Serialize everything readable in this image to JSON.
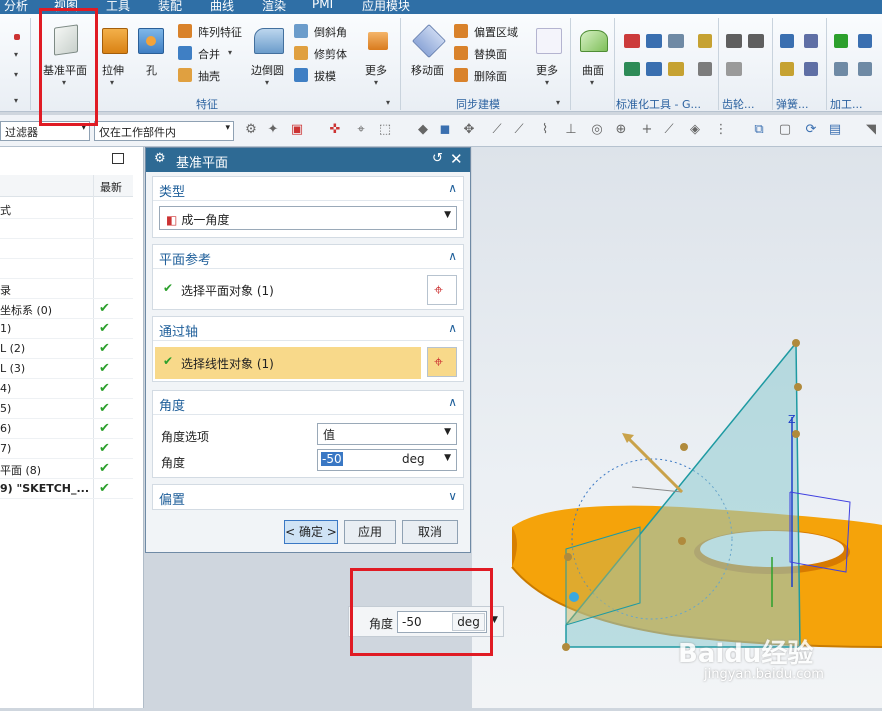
{
  "menubar": {
    "items": [
      "分析",
      "视图",
      "工具",
      "装配",
      "曲线",
      "渲染",
      "PMI",
      "应用模块"
    ]
  },
  "ribbon": {
    "datum_plane": "基准平面",
    "extrude": "拉伸",
    "hole": "孔",
    "pattern": "阵列特征",
    "unite": "合并",
    "shell": "抽壳",
    "edge_blend": "边倒圆",
    "chamfer": "倒斜角",
    "trim_body": "修剪体",
    "draft": "拔模",
    "more1": "更多",
    "group_feature": "特征",
    "move_face": "移动面",
    "offset_region": "偏置区域",
    "replace_face": "替换面",
    "delete_face": "删除面",
    "more2": "更多",
    "group_sync": "同步建模",
    "surface": "曲面",
    "group_std": "标准化工具 - G...",
    "group_gear": "齿轮...",
    "group_spring": "弹簧...",
    "group_machining": "加工..."
  },
  "toolbar2": {
    "filter": "过滤器",
    "scope": "仅在工作部件内"
  },
  "nav": {
    "col_latest": "最新",
    "rows": [
      {
        "label": "式",
        "check": false
      },
      {
        "label": "",
        "check": false
      },
      {
        "label": "",
        "check": false
      },
      {
        "label": "",
        "check": false
      },
      {
        "label": "录",
        "check": false
      },
      {
        "label": "坐标系 (0)",
        "check": true
      },
      {
        "label": "1)",
        "check": true
      },
      {
        "label": "L (2)",
        "check": true
      },
      {
        "label": "L (3)",
        "check": true
      },
      {
        "label": "4)",
        "check": true
      },
      {
        "label": "5)",
        "check": true
      },
      {
        "label": "6)",
        "check": true
      },
      {
        "label": "7)",
        "check": true
      },
      {
        "label": "平面 (8)",
        "check": true
      },
      {
        "label": "9) \"SKETCH_...",
        "check": true
      }
    ]
  },
  "dialog": {
    "title": "基准平面",
    "type": {
      "header": "类型",
      "value": "成一角度"
    },
    "plane_ref": {
      "header": "平面参考",
      "label": "选择平面对象 (1)"
    },
    "through_axis": {
      "header": "通过轴",
      "label": "选择线性对象 (1)"
    },
    "angle": {
      "header": "角度",
      "option_label": "角度选项",
      "option_value": "值",
      "angle_label": "角度",
      "angle_value": "-50",
      "unit": "deg"
    },
    "offset": {
      "header": "偏置"
    },
    "ok": "< 确定 >",
    "apply": "应用",
    "cancel": "取消"
  },
  "floating": {
    "label": "角度",
    "value": "-50",
    "unit": "deg"
  },
  "viewport": {
    "axis_label": "Z"
  },
  "watermark": {
    "brand": "Baidu经验",
    "url": "jingyan.baidu.com"
  },
  "colors": {
    "accent": "#2e6a94",
    "highlight": "#f8d98a",
    "check": "#2ca02c",
    "annotation": "#e01b24",
    "part": "#f5a30a",
    "plane": "#8ecbd0"
  }
}
